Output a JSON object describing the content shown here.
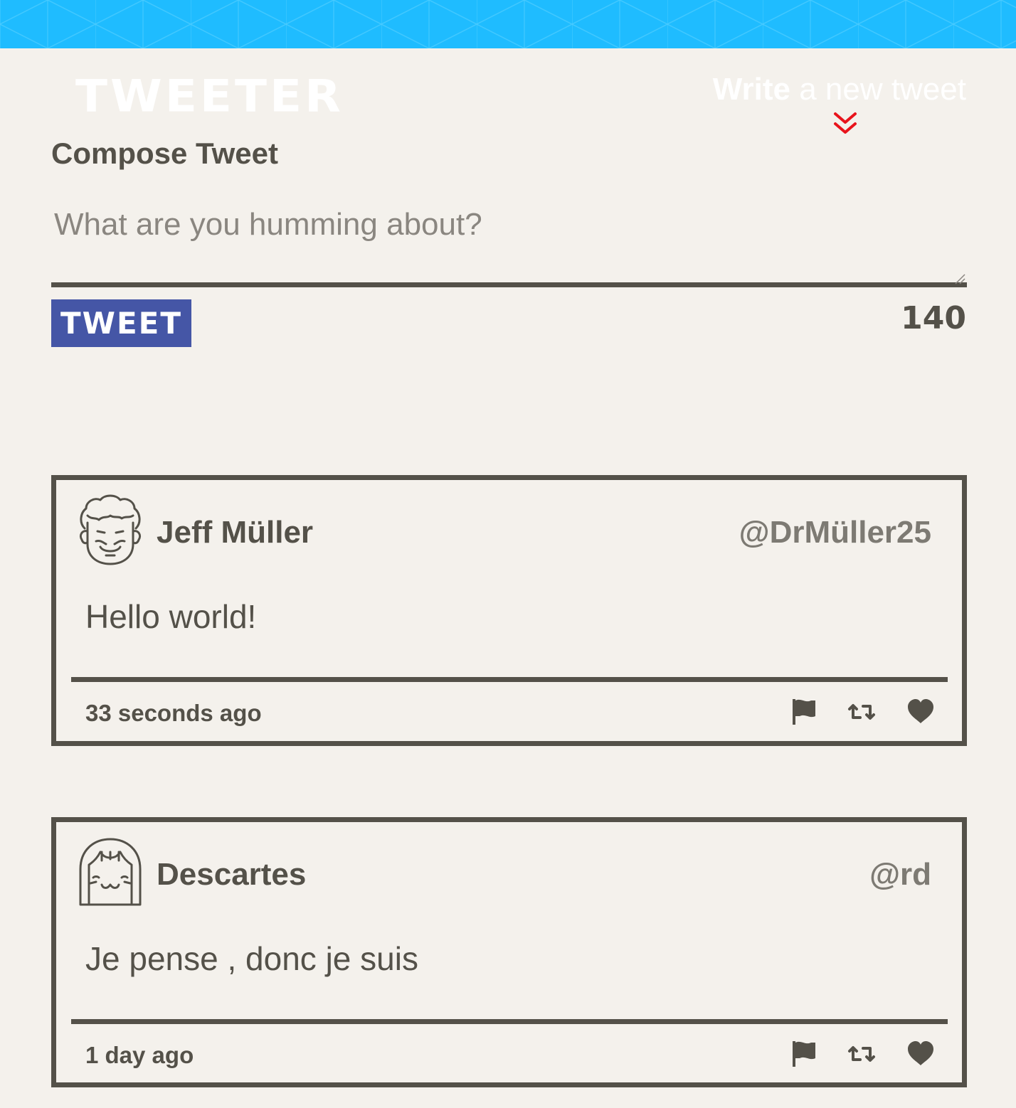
{
  "header": {
    "brand": "TWEETER",
    "write_link_strong": "Write",
    "write_link_rest": " a new tweet",
    "banner_color": "#1fbcff",
    "chevron_icon": "double-chevron-down-icon",
    "chevron_color": "#e8141c"
  },
  "composer": {
    "title": "Compose Tweet",
    "placeholder": "What are you humming about?",
    "value": "",
    "button_label": "TWEET",
    "button_color": "#4556a6",
    "char_count": "140"
  },
  "tweets": [
    {
      "name": "Jeff Müller",
      "handle": "@DrMüller25",
      "text": "Hello world!",
      "time": "33 seconds ago",
      "avatar_icon": "curly-hair-avatar-icon",
      "actions": [
        "flag-icon",
        "retweet-icon",
        "heart-icon"
      ]
    },
    {
      "name": "Descartes",
      "handle": "@rd",
      "text": "Je pense , donc je suis",
      "time": "1 day ago",
      "avatar_icon": "bob-hair-avatar-icon",
      "actions": [
        "flag-icon",
        "retweet-icon",
        "heart-icon"
      ]
    }
  ]
}
